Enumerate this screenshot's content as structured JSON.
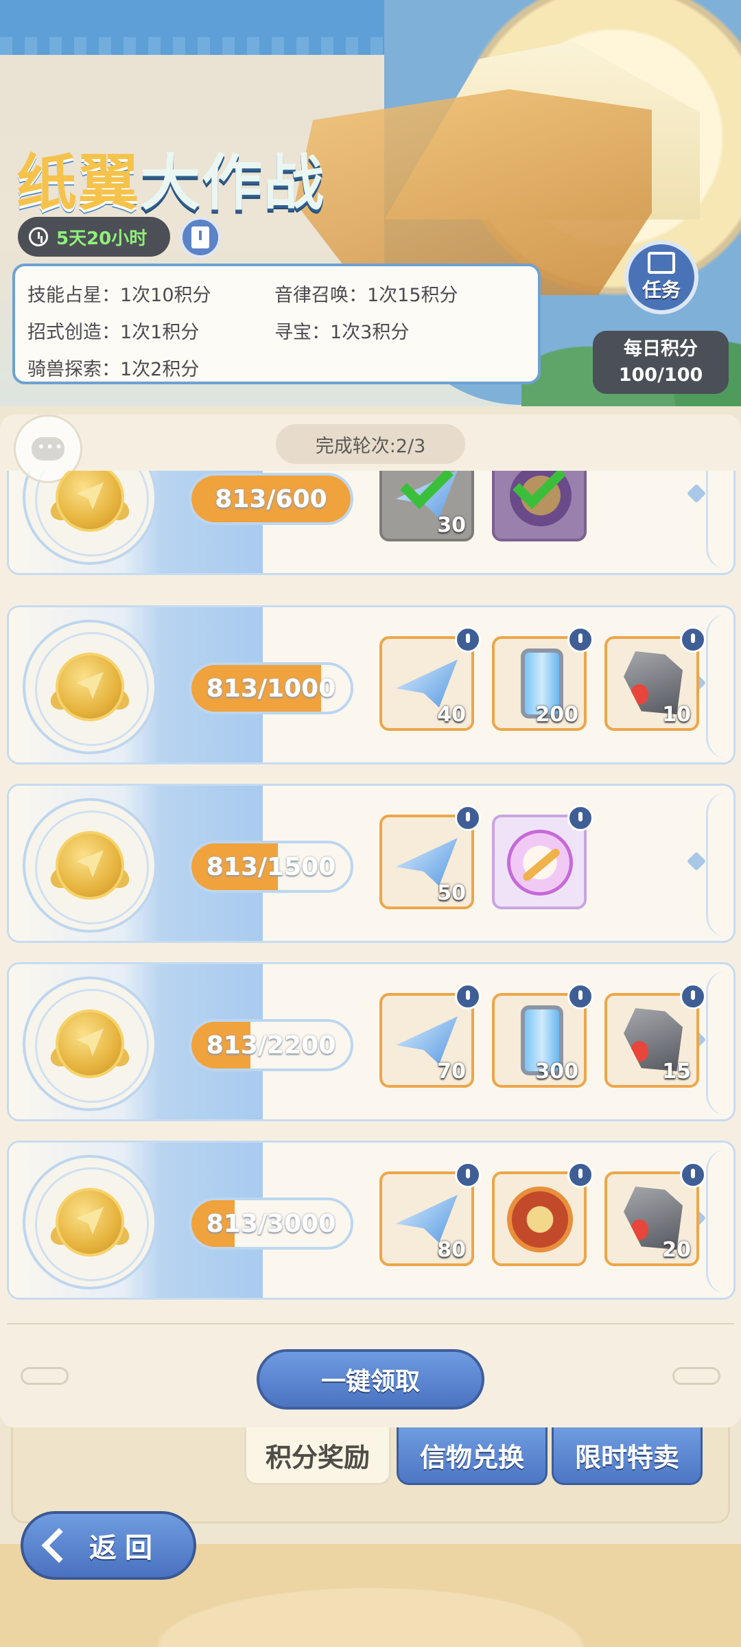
{
  "event": {
    "title_part1": "纸翼",
    "title_part2": "大作战",
    "time_left": "5天20小时"
  },
  "rules": [
    [
      "技能占星：1次10积分",
      "音律召唤：1次15积分"
    ],
    [
      "招式创造：1次1积分",
      "寻宝：1次3积分"
    ],
    [
      "骑兽探索：1次2积分",
      ""
    ]
  ],
  "task_button": {
    "label": "任务"
  },
  "daily_points": {
    "label": "每日积分",
    "value": "100/100"
  },
  "rounds": "完成轮次:2/3",
  "tiers": [
    {
      "progress": "813/600",
      "current": 813,
      "target": 600,
      "rewards": [
        {
          "item": "paper-plane",
          "qty": "30",
          "claimed": true
        },
        {
          "item": "emblem-coin",
          "qty": "",
          "claimed": true
        }
      ]
    },
    {
      "progress": "813/1000",
      "current": 813,
      "target": 1000,
      "rewards": [
        {
          "item": "paper-plane",
          "qty": "40",
          "claimed": false
        },
        {
          "item": "energy-tank",
          "qty": "200",
          "claimed": false
        },
        {
          "item": "fire-ore",
          "qty": "10",
          "claimed": false
        }
      ]
    },
    {
      "progress": "813/1500",
      "current": 813,
      "target": 1500,
      "rewards": [
        {
          "item": "paper-plane",
          "qty": "50",
          "claimed": false
        },
        {
          "item": "sword-emblem",
          "qty": "",
          "claimed": false
        }
      ]
    },
    {
      "progress": "813/2200",
      "current": 813,
      "target": 2200,
      "rewards": [
        {
          "item": "paper-plane",
          "qty": "70",
          "claimed": false
        },
        {
          "item": "energy-tank",
          "qty": "300",
          "claimed": false
        },
        {
          "item": "fire-ore",
          "qty": "15",
          "claimed": false
        }
      ]
    },
    {
      "progress": "813/3000",
      "current": 813,
      "target": 3000,
      "rewards": [
        {
          "item": "paper-plane",
          "qty": "80",
          "claimed": false
        },
        {
          "item": "spell-book",
          "qty": "",
          "claimed": false
        },
        {
          "item": "fire-ore",
          "qty": "20",
          "claimed": false
        }
      ]
    }
  ],
  "claim_all_label": "一键领取",
  "tabs": [
    "积分奖励",
    "信物兑换",
    "限时特卖"
  ],
  "back_label": "返回"
}
